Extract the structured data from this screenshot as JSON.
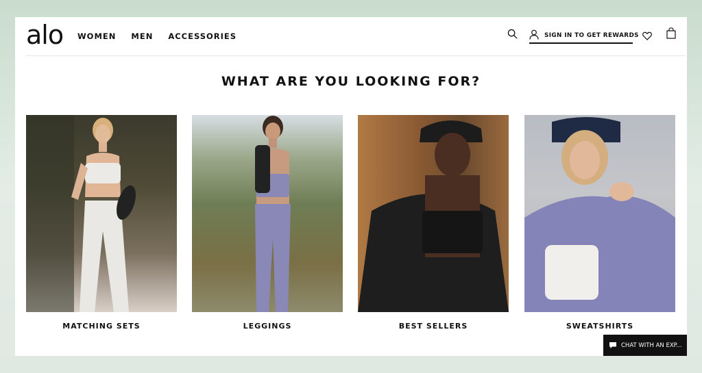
{
  "brand": {
    "logo_text": "alo"
  },
  "nav": {
    "items": [
      "WOMEN",
      "MEN",
      "ACCESSORIES"
    ]
  },
  "header": {
    "search_icon": "search-icon",
    "rewards_label": "SIGN IN TO GET REWARDS",
    "wishlist_icon": "heart-icon",
    "bag_icon": "shopping-bag-icon"
  },
  "main": {
    "heading": "WHAT ARE YOU LOOKING FOR?",
    "categories": [
      {
        "label": "MATCHING SETS"
      },
      {
        "label": "LEGGINGS"
      },
      {
        "label": "BEST SELLERS"
      },
      {
        "label": "SWEATSHIRTS"
      }
    ]
  },
  "chat": {
    "label": "CHAT WITH AN EXP..."
  },
  "colors": {
    "page_bg": "#ffffff",
    "backdrop": "#d4e3d8",
    "text": "#111111",
    "chat_bg": "#111111"
  }
}
